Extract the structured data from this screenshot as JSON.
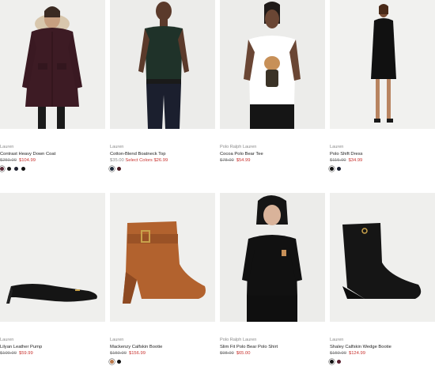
{
  "products": [
    {
      "brand": "Lauren",
      "name": "Contrast Heavy Down Coat",
      "was": "$250.00",
      "now": "$104.99",
      "note": "",
      "swatches": [
        "#5a2a36",
        "#1a1a1a",
        "#1f2230",
        "#111111"
      ]
    },
    {
      "brand": "Lauren",
      "name": "Cotton-Blend Boatneck Top",
      "was": "",
      "now": "$35.00",
      "note": "Select Colors $26.99",
      "swatches": [
        "#1f2a3a",
        "#4a1a22"
      ]
    },
    {
      "brand": "Polo Ralph Lauren",
      "name": "Cocoa Polo Bear Tee",
      "was": "$78.00",
      "now": "$54.99",
      "note": "",
      "swatches": []
    },
    {
      "brand": "Lauren",
      "name": "Polo Shift Dress",
      "was": "$115.00",
      "now": "$34.99",
      "note": "",
      "swatches": [
        "#111111",
        "#1b2030"
      ]
    },
    {
      "brand": "Lauren",
      "name": "Lilyan Leather Pump",
      "was": "$100.00",
      "now": "$59.99",
      "note": "",
      "swatches": []
    },
    {
      "brand": "Lauren",
      "name": "Mackenzy Calfskin Bootie",
      "was": "$150.00",
      "now": "$156.99",
      "note": "",
      "swatches": [
        "#b9774a",
        "#111111"
      ]
    },
    {
      "brand": "Polo Ralph Lauren",
      "name": "Slim Fit Polo Bear Polo Shirt",
      "was": "$98.00",
      "now": "$65.00",
      "note": "",
      "swatches": []
    },
    {
      "brand": "Lauren",
      "name": "Shaley Calfskin Wedge Bootie",
      "was": "$150.00",
      "now": "$124.99",
      "note": "",
      "swatches": [
        "#111111",
        "#5a2030"
      ]
    }
  ]
}
